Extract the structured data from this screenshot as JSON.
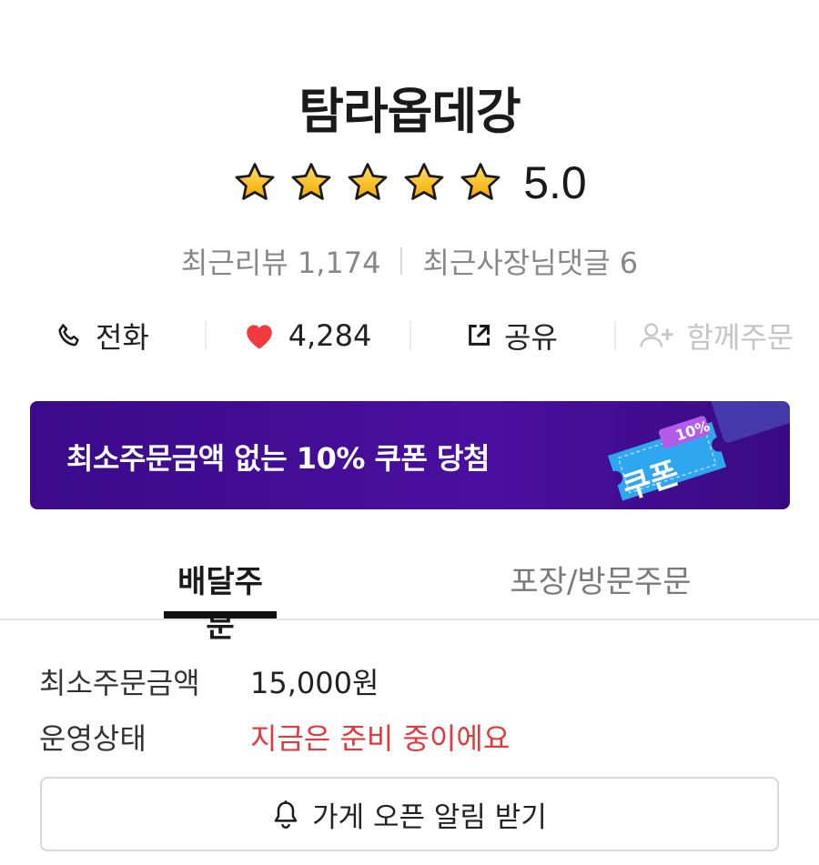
{
  "store": {
    "name": "탐라옵데강",
    "rating": "5.0",
    "rating_stars": 5,
    "recent_reviews_label": "최근리뷰 1,174",
    "owner_replies_label": "최근사장님댓글 6"
  },
  "actions": {
    "call_label": "전화",
    "likes_count": "4,284",
    "share_label": "공유",
    "group_order_label": "함께주문"
  },
  "banner": {
    "text": "최소주문금액 없는 10% 쿠폰 당첨",
    "coupon_word": "쿠폰",
    "coupon_percent": "10%",
    "background_color": "#4a0f9e"
  },
  "tabs": [
    {
      "label": "배달주문",
      "active": true
    },
    {
      "label": "포장/방문주문",
      "active": false
    }
  ],
  "order_info": {
    "min_order_label": "최소주문금액",
    "min_order_value": "15,000원",
    "status_label": "운영상태",
    "status_value": "지금은 준비 중이에요",
    "status_color": "#e3393d"
  },
  "notify_button": {
    "label": "가게 오픈 알림 받기",
    "icon": "bell-icon"
  }
}
